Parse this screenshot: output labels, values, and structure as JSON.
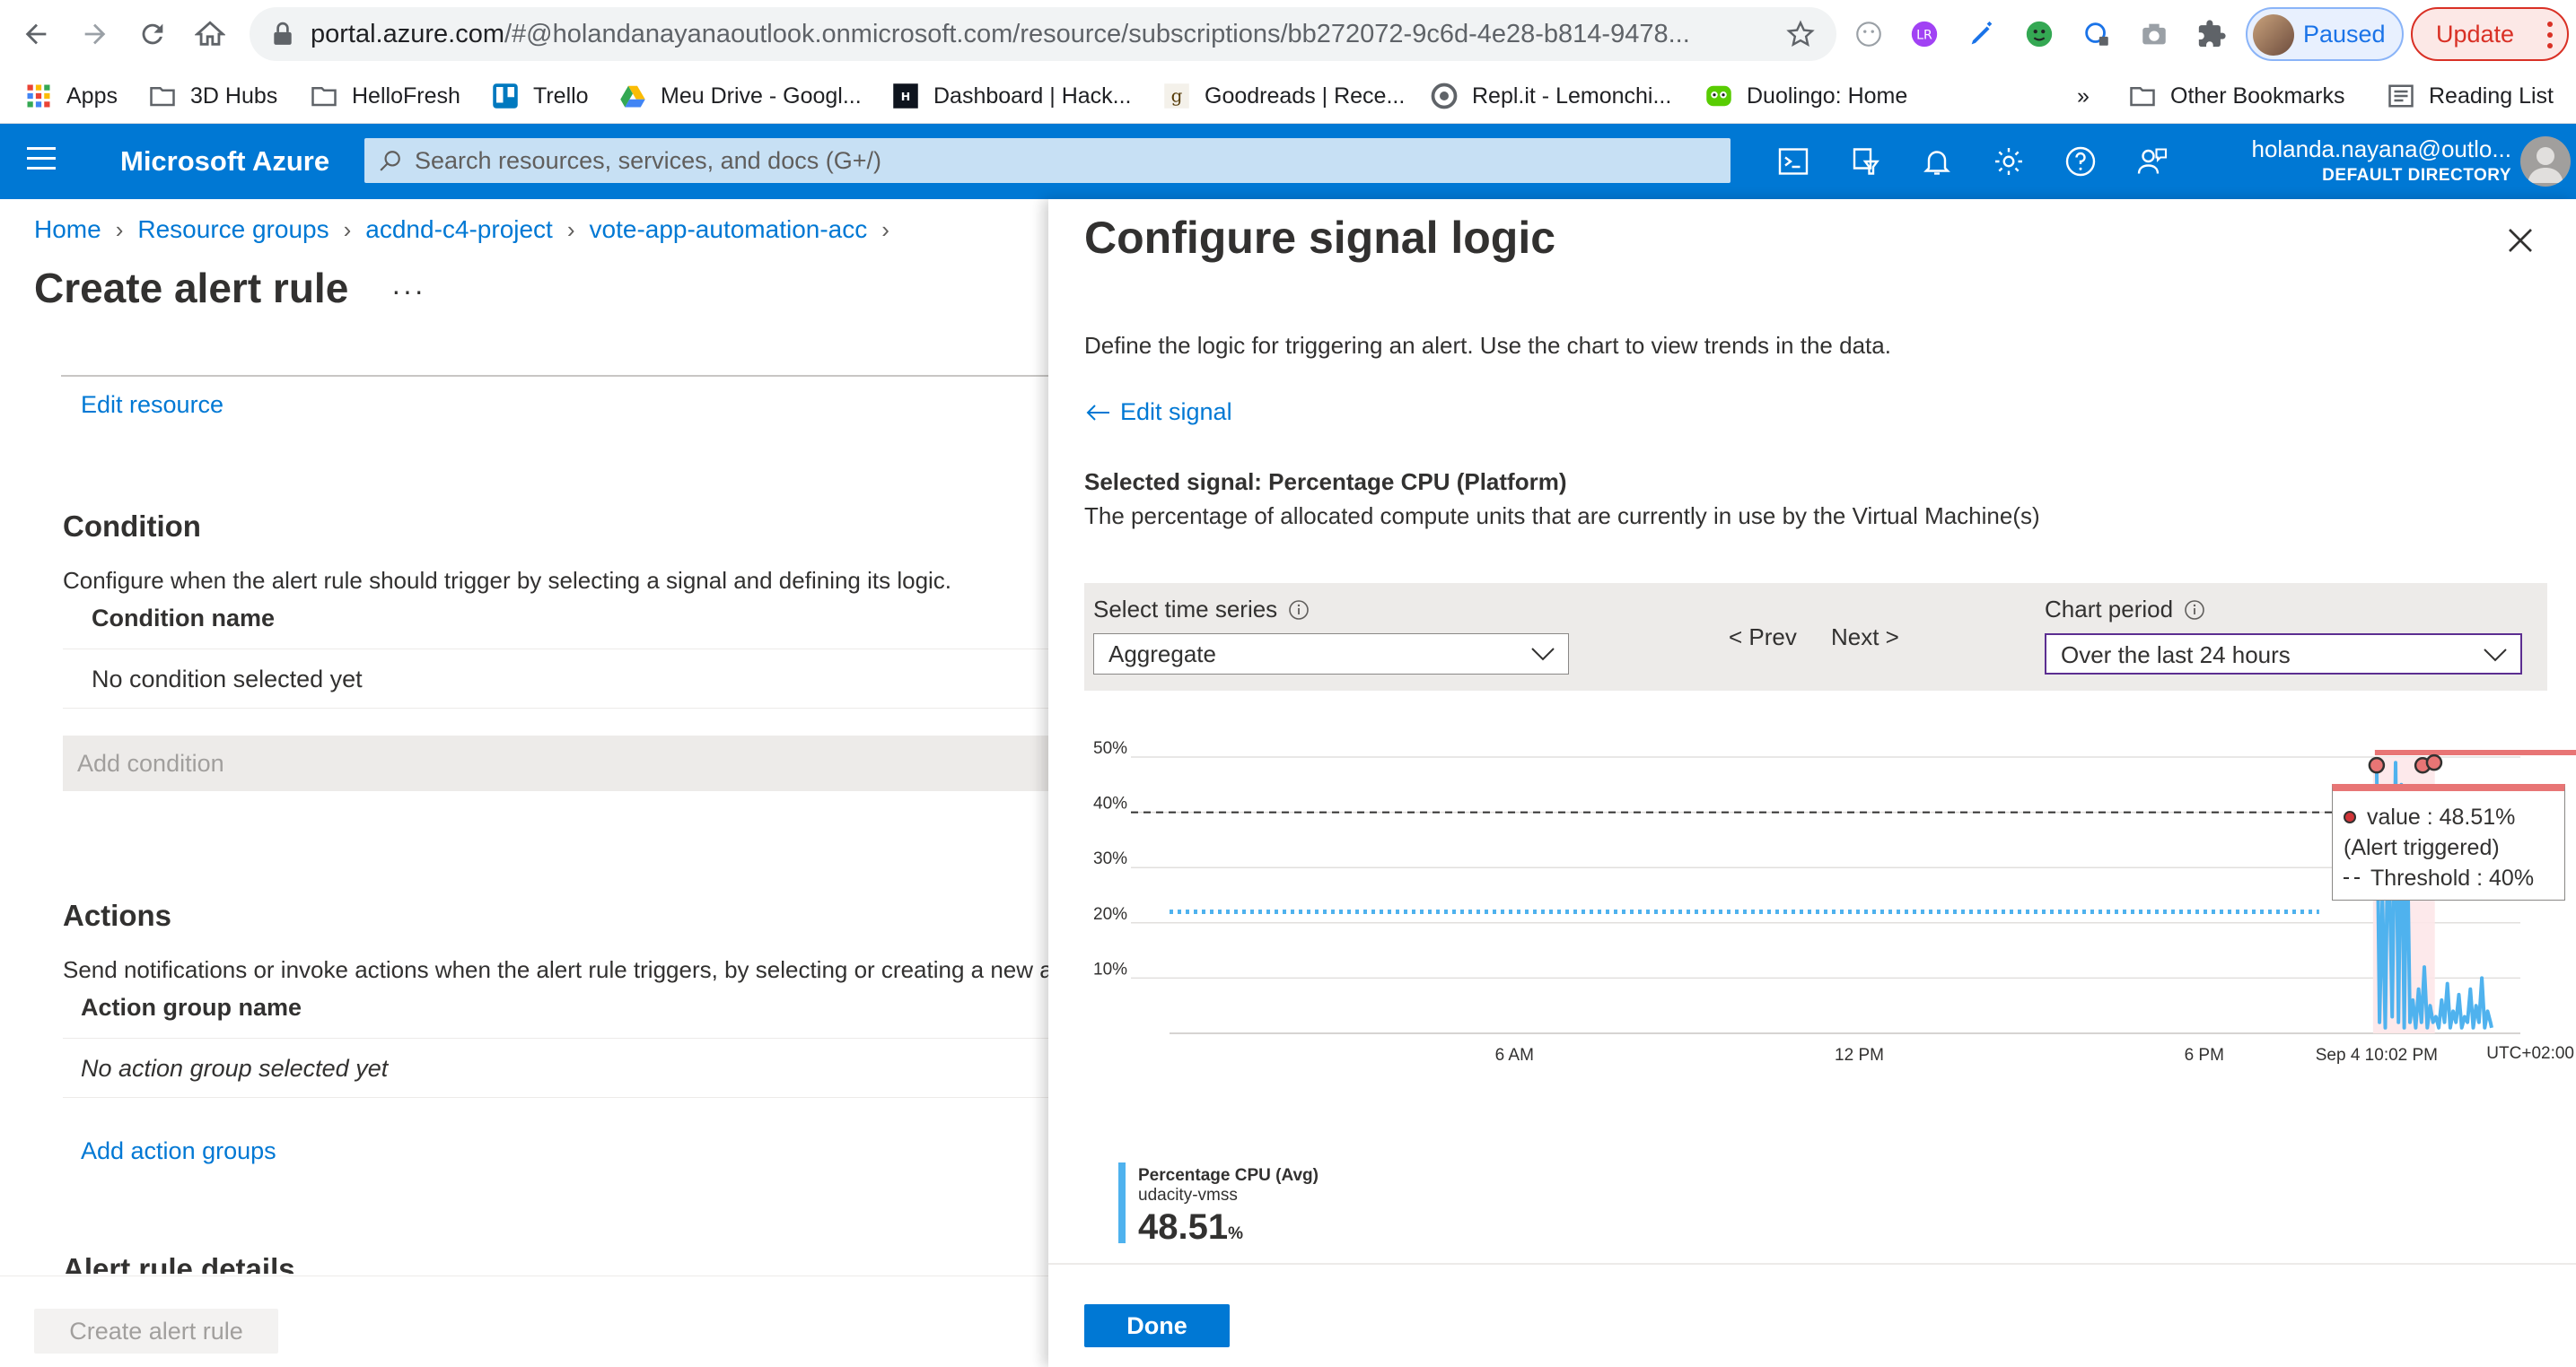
{
  "browser": {
    "url_host": "portal.azure.com",
    "url_rest": "/#@holandanayanaoutlook.onmicrosoft.com/resource/subscriptions/bb272072-9c6d-4e28-b814-9478...",
    "profile_status": "Paused",
    "update_label": "Update"
  },
  "bookmarks": {
    "items": [
      "Apps",
      "3D Hubs",
      "HelloFresh",
      "Trello",
      "Meu Drive - Googl...",
      "Dashboard | Hack...",
      "Goodreads | Rece...",
      "Repl.it - Lemonchi...",
      "Duolingo: Home"
    ],
    "overflow": "»",
    "other": "Other Bookmarks",
    "reading_list": "Reading List"
  },
  "azure": {
    "brand": "Microsoft Azure",
    "search_placeholder": "Search resources, services, and docs (G+/)",
    "account_email": "holanda.nayana@outlo...",
    "account_directory": "DEFAULT DIRECTORY"
  },
  "left": {
    "breadcrumb": [
      "Home",
      "Resource groups",
      "acdnd-c4-project",
      "vote-app-automation-acc"
    ],
    "title": "Create alert rule",
    "more": "···",
    "edit_resource": "Edit resource",
    "condition": {
      "heading": "Condition",
      "desc": "Configure when the alert rule should trigger by selecting a signal and defining its logic.",
      "col_header": "Condition name",
      "empty_row": "No condition selected yet",
      "add": "Add condition"
    },
    "actions": {
      "heading": "Actions",
      "desc": "Send notifications or invoke actions when the alert rule triggers, by selecting or creating a new a",
      "col_header": "Action group name",
      "empty_row": "No action group selected yet",
      "add": "Add action groups"
    },
    "details_heading": "Alert rule details",
    "create_button": "Create alert rule"
  },
  "right": {
    "title": "Configure signal logic",
    "desc": "Define the logic for triggering an alert. Use the chart to view trends in the data.",
    "edit_signal": "Edit signal",
    "selected_signal": "Selected signal: Percentage CPU (Platform)",
    "signal_desc": "The percentage of allocated compute units that are currently in use by the Virtual Machine(s)",
    "time_series_label": "Select time series",
    "time_series_value": "Aggregate",
    "prev": "< Prev",
    "next": "Next >",
    "chart_period_label": "Chart period",
    "chart_period_value": "Over the last 24 hours",
    "done": "Done",
    "tooltip": {
      "value": "value : 48.51%",
      "triggered": "(Alert triggered)",
      "threshold": "Threshold : 40%"
    },
    "legend": {
      "metric": "Percentage CPU (Avg)",
      "resource": "udacity-vmss",
      "value": "48.51",
      "unit": "%"
    }
  },
  "colors": {
    "azure_blue": "#0078d4",
    "series": "#4fb2ee",
    "alert_red": "#e87575"
  },
  "chart_data": {
    "type": "line",
    "y_ticks": [
      "10%",
      "20%",
      "30%",
      "40%",
      "50%"
    ],
    "x_ticks": [
      "6 AM",
      "12 PM",
      "6 PM",
      "Sep 4 10:02 PM"
    ],
    "timezone": "UTC+02:00",
    "ylim": [
      0,
      50
    ],
    "threshold": 40,
    "series": [
      {
        "name": "Percentage CPU (Avg)",
        "style": "dotted",
        "x": [
          0,
          1,
          2,
          3,
          4,
          5,
          6,
          7,
          8,
          9,
          10,
          11,
          12,
          13,
          14,
          15,
          16,
          17,
          18,
          19,
          20
        ],
        "values": [
          22,
          22,
          22,
          22,
          22,
          22,
          22,
          22,
          22,
          22,
          22,
          22,
          22,
          22,
          22,
          22,
          22,
          22,
          22,
          22,
          22
        ]
      },
      {
        "name": "Percentage CPU (Avg)",
        "style": "solid",
        "x": [
          21.0,
          21.05,
          21.1,
          21.15,
          21.2,
          21.27,
          21.33,
          21.38,
          21.43,
          21.48,
          21.53,
          21.58,
          21.63,
          21.68,
          21.73,
          21.78,
          21.83,
          21.88,
          21.93,
          21.98,
          22.03,
          22.08,
          22.13,
          22.18,
          22.23,
          22.28,
          22.33,
          22.38,
          22.43,
          22.48,
          22.53,
          22.58,
          22.63,
          22.68,
          22.73,
          22.78,
          22.83,
          22.88,
          22.93,
          22.98,
          23.0
        ],
        "values": [
          48.5,
          2,
          25,
          1,
          40,
          3,
          49,
          2,
          45,
          1,
          38,
          2,
          6,
          1,
          8,
          2,
          12,
          1,
          5,
          2,
          3,
          1,
          6,
          2,
          9,
          1,
          4,
          2,
          7,
          1,
          3,
          2,
          8,
          1,
          5,
          2,
          10,
          1,
          4,
          2,
          1
        ]
      }
    ],
    "alert_points": [
      {
        "x": 21.0,
        "y": 48.51
      },
      {
        "x": 21.8,
        "y": 48.5
      },
      {
        "x": 22.0,
        "y": 49.0
      }
    ]
  }
}
